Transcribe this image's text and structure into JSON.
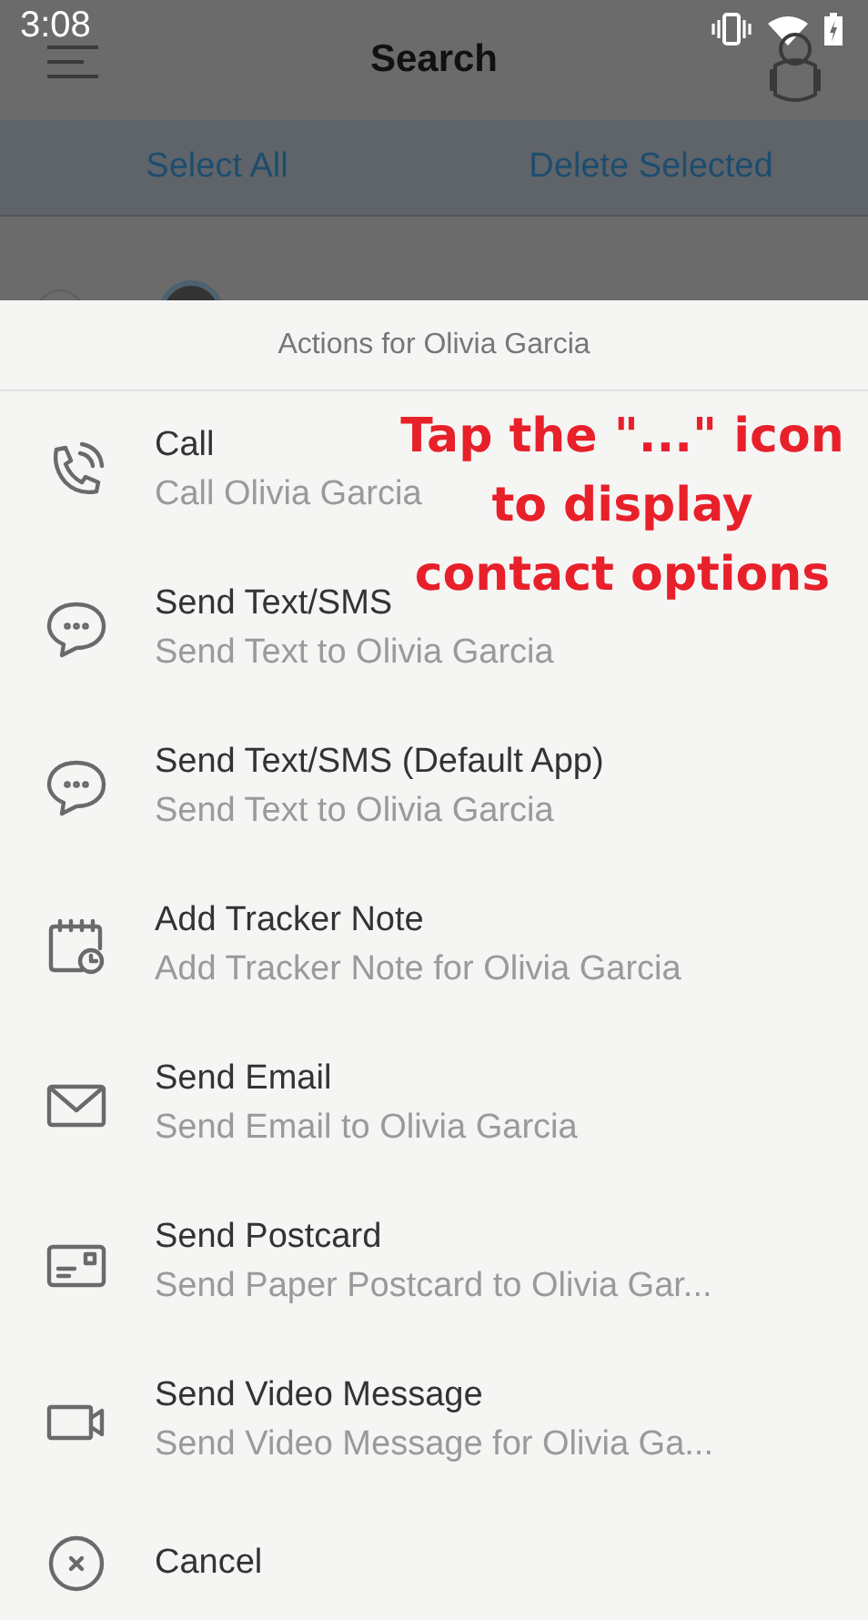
{
  "status_bar": {
    "time": "3:08"
  },
  "app_bar": {
    "title": "Search"
  },
  "toolbar": {
    "buttons": [
      "Select All",
      "Delete Selected"
    ]
  },
  "contacts": [
    {
      "selected": false
    }
  ],
  "action_sheet": {
    "title": "Actions for Olivia Garcia",
    "actions": [
      {
        "kind": "call",
        "title": "Call",
        "subtitle": "Call Olivia Garcia"
      },
      {
        "kind": "sms",
        "title": "Send Text/SMS",
        "subtitle": "Send Text to Olivia Garcia"
      },
      {
        "kind": "sms",
        "title": "Send Text/SMS (Default App)",
        "subtitle": "Send Text to Olivia Garcia"
      },
      {
        "kind": "note",
        "title": "Add Tracker Note",
        "subtitle": "Add Tracker Note for Olivia Garcia"
      },
      {
        "kind": "email",
        "title": "Send Email",
        "subtitle": "Send Email to Olivia Garcia"
      },
      {
        "kind": "postcard",
        "title": "Send Postcard",
        "subtitle": "Send Paper Postcard to Olivia Gar..."
      },
      {
        "kind": "video",
        "title": "Send Video Message",
        "subtitle": "Send Video Message for Olivia Ga..."
      },
      {
        "kind": "cancel",
        "title": "Cancel"
      }
    ]
  },
  "callout": {
    "lines": [
      "Tap the \"...\" icon",
      "to display",
      "contact options"
    ]
  }
}
